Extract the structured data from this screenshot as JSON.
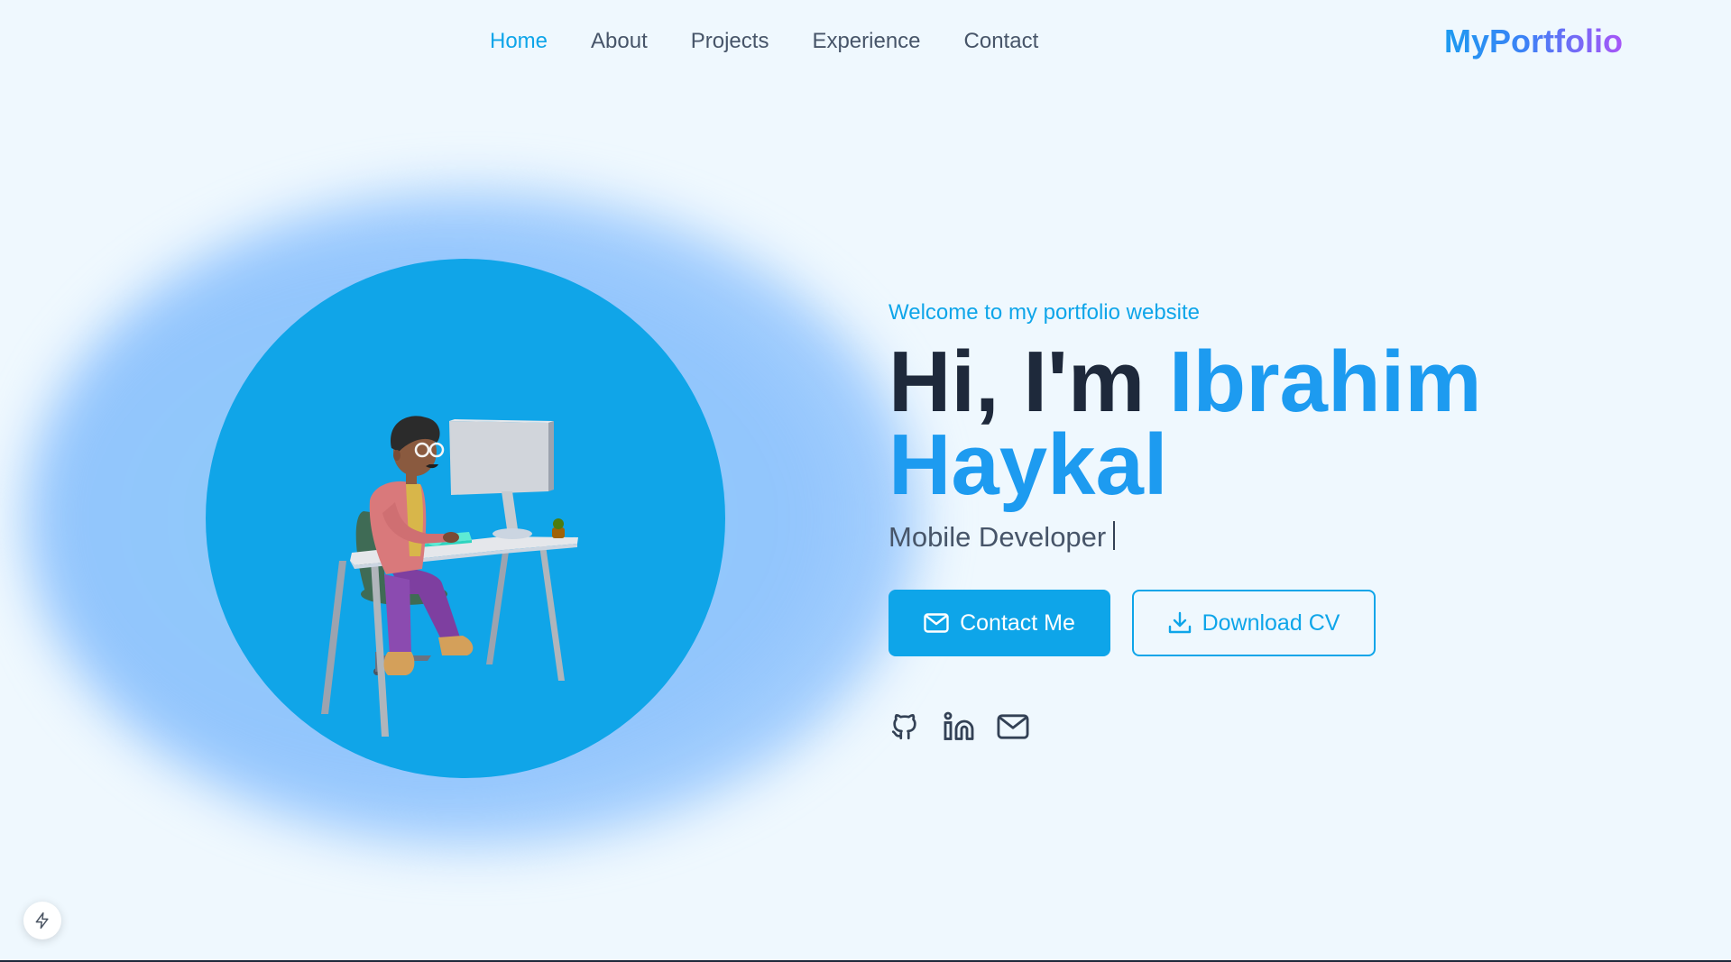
{
  "nav": {
    "links": [
      {
        "label": "Home",
        "active": true
      },
      {
        "label": "About",
        "active": false
      },
      {
        "label": "Projects",
        "active": false
      },
      {
        "label": "Experience",
        "active": false
      },
      {
        "label": "Contact",
        "active": false
      }
    ],
    "brand": "MyPortfolio"
  },
  "hero": {
    "welcome": "Welcome to my portfolio website",
    "greeting": "Hi, I'm",
    "first_name": "Ibrahim",
    "last_name": "Haykal",
    "role": "Mobile Developer",
    "illustration": "person-at-desk-illustration",
    "buttons": {
      "contact": {
        "label": "Contact Me",
        "icon": "mail-icon"
      },
      "download": {
        "label": "Download CV",
        "icon": "download-icon"
      }
    },
    "socials": [
      {
        "name": "github-icon"
      },
      {
        "name": "linkedin-icon"
      },
      {
        "name": "mail-icon"
      }
    ]
  },
  "corner_badge": {
    "icon": "lightning-bolt-icon"
  },
  "colors": {
    "accent": "#0ea5e9",
    "name": "#1d9bf0",
    "heading": "#1e293b",
    "text": "#475569",
    "background": "#eff8fe",
    "circle": "#10a5e8",
    "glow": "#93c5fd",
    "brand_gradient": [
      "#1d9bf0",
      "#a855f7"
    ]
  }
}
